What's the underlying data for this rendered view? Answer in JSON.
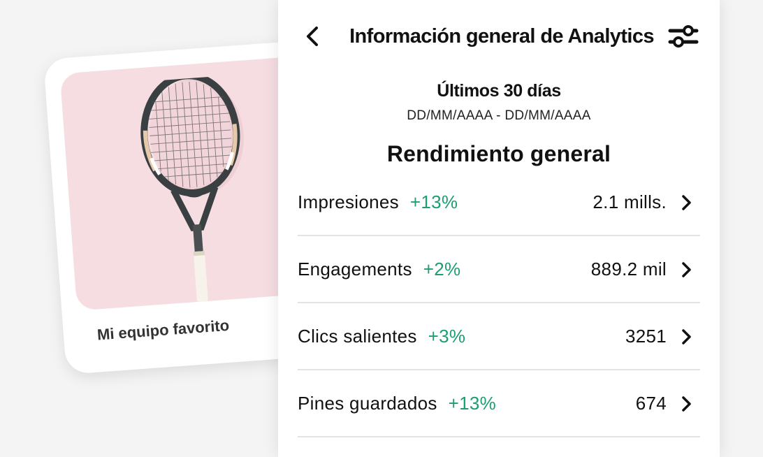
{
  "pin": {
    "title": "Mi equipo favorito",
    "image": "tennis-racket-image"
  },
  "header": {
    "title": "Información general de Analytics",
    "back_icon": "chevron-left-icon",
    "filter_icon": "sliders-icon"
  },
  "date_range": {
    "label": "Últimos 30 días",
    "dates": "DD/MM/AAAA - DD/MM/AAAA"
  },
  "section": {
    "title": "Rendimiento general"
  },
  "metrics": [
    {
      "name": "Impresiones",
      "change": "+13%",
      "value": "2.1 mills."
    },
    {
      "name": "Engagements",
      "change": "+2%",
      "value": "889.2 mil"
    },
    {
      "name": "Clics salientes",
      "change": "+3%",
      "value": "3251"
    },
    {
      "name": "Pines guardados",
      "change": "+13%",
      "value": "674"
    }
  ],
  "colors": {
    "positive_change": "#1d9e6e",
    "pin_background": "#f5dde2",
    "page_background": "#f4f4f4"
  }
}
